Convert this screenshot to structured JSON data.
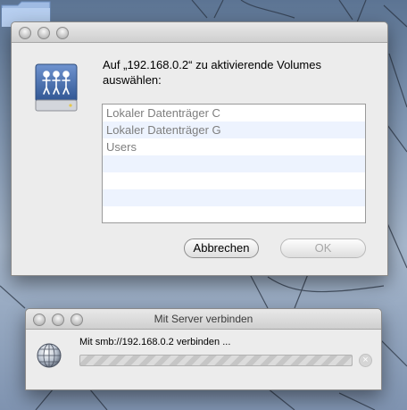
{
  "dialog": {
    "prompt": "Auf „192.168.0.2“ zu aktivierende Volumes auswählen:",
    "volumes": [
      {
        "label": "Lokaler Datenträger C"
      },
      {
        "label": "Lokaler Datenträger G"
      },
      {
        "label": "Users"
      },
      {
        "label": ""
      },
      {
        "label": ""
      },
      {
        "label": ""
      },
      {
        "label": ""
      }
    ],
    "cancel_label": "Abbrechen",
    "ok_label": "OK"
  },
  "progress_window": {
    "title": "Mit Server verbinden",
    "status_text": "Mit smb://192.168.0.2 verbinden ...",
    "progress_state": "indeterminate"
  },
  "colors": {
    "desktop": "#7f93b0",
    "window": "#ececec",
    "list_alt_row": "#edf3fe",
    "server_icon": "#4a6ea8"
  },
  "icons": {
    "folder": "folder-icon",
    "server": "shared-server-icon",
    "network": "network-globe-icon",
    "stop": "stop-icon"
  }
}
